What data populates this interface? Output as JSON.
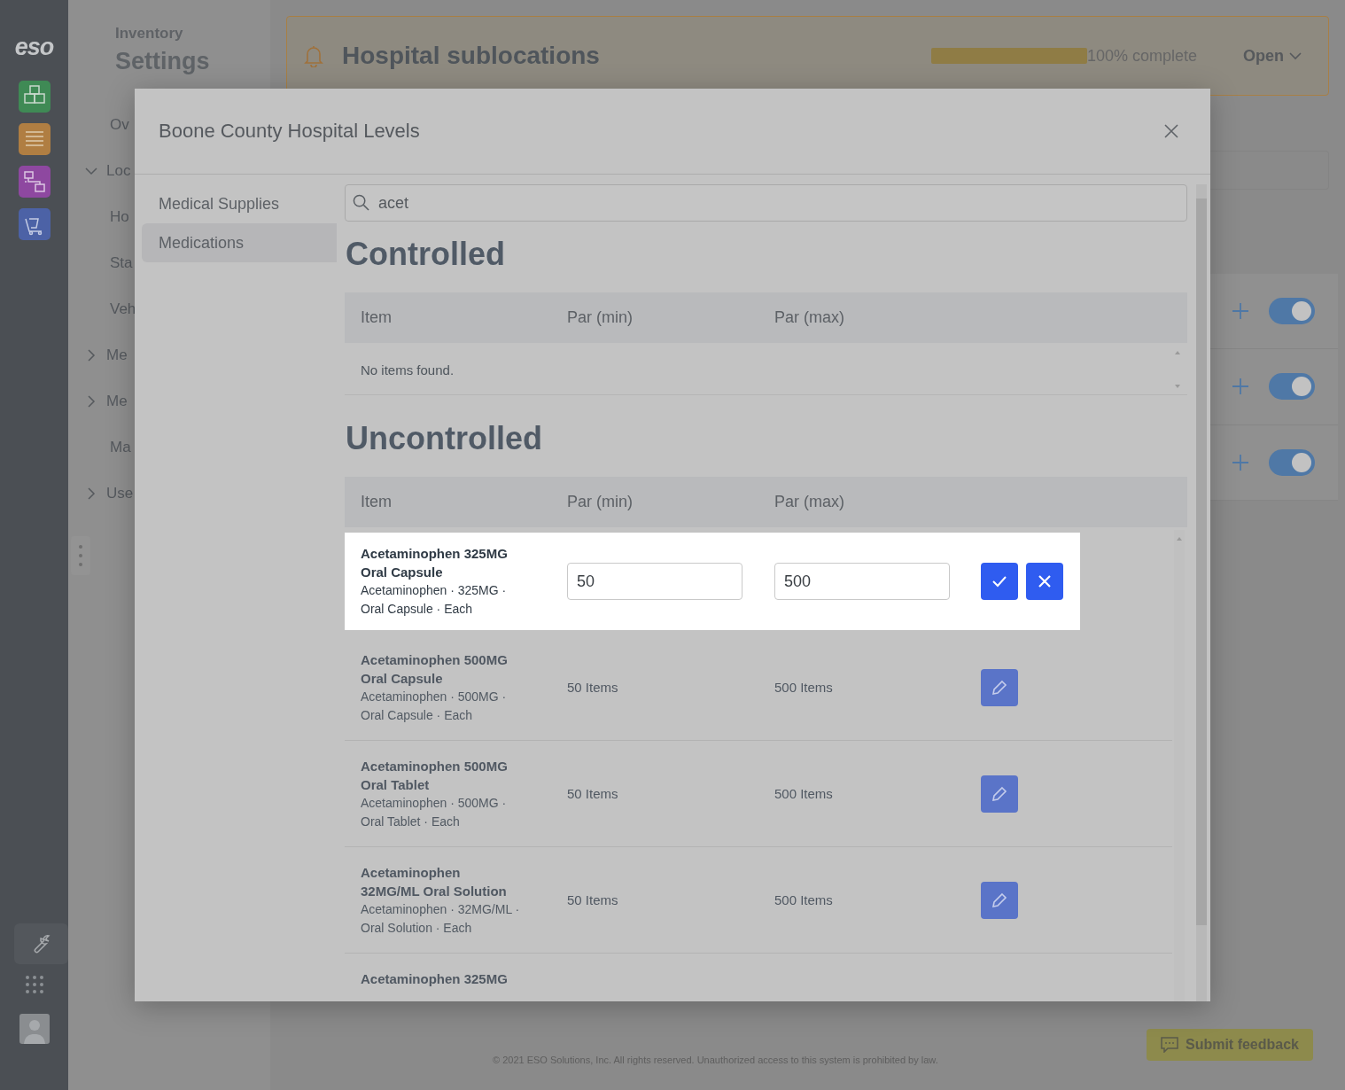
{
  "rail": {
    "logo": "eso"
  },
  "settings_nav": {
    "eyebrow": "Inventory",
    "title": "Settings",
    "items": [
      {
        "kind": "link",
        "label": "Ov"
      },
      {
        "kind": "group",
        "label": "Loc",
        "expanded": true,
        "children": [
          {
            "label": "Ho"
          },
          {
            "label": "Sta"
          },
          {
            "label": "Veh"
          }
        ]
      },
      {
        "kind": "group",
        "label": "Me",
        "expanded": false
      },
      {
        "kind": "group",
        "label": "Me",
        "expanded": false
      },
      {
        "kind": "link",
        "label": "Ma"
      },
      {
        "kind": "group",
        "label": "Use",
        "expanded": false
      }
    ]
  },
  "banner": {
    "title": "Hospital sublocations",
    "progress": {
      "level": 1,
      "label": "100% complete"
    },
    "action": "Open"
  },
  "side_list": {
    "rows": [
      {
        "on": true
      },
      {
        "on": true
      },
      {
        "on": true
      }
    ]
  },
  "footer": {
    "copyright": "© 2021 ESO Solutions, Inc. All rights reserved. Unauthorized access to this system is prohibited by law.",
    "feedback": "Submit feedback"
  },
  "modal": {
    "title": "Boone County Hospital Levels",
    "nav": [
      {
        "label": "Medical Supplies",
        "selected": false
      },
      {
        "label": "Medications",
        "selected": true
      }
    ],
    "search": {
      "value": "acet"
    },
    "sections": [
      {
        "title": "Controlled",
        "columns": [
          "Item",
          "Par (min)",
          "Par (max)"
        ],
        "empty": "No items found."
      },
      {
        "title": "Uncontrolled",
        "columns": [
          "Item",
          "Par (min)",
          "Par (max)"
        ],
        "rows": [
          {
            "name": "Acetaminophen 325MG Oral Capsule",
            "detail": "Acetaminophen · 325MG · Oral Capsule · Each",
            "editing": true,
            "min": "50",
            "max": "500"
          },
          {
            "name": "Acetaminophen 500MG Oral Capsule",
            "detail": "Acetaminophen · 500MG · Oral Capsule · Each",
            "editing": false,
            "min": "50 Items",
            "max": "500 Items"
          },
          {
            "name": "Acetaminophen 500MG Oral Tablet",
            "detail": "Acetaminophen · 500MG · Oral Tablet · Each",
            "editing": false,
            "min": "50 Items",
            "max": "500 Items"
          },
          {
            "name": "Acetaminophen 32MG/ML Oral Solution",
            "detail": "Acetaminophen · 32MG/ML · Oral Solution · Each",
            "editing": false,
            "min": "50 Items",
            "max": "500 Items"
          },
          {
            "name": "Acetaminophen 325MG",
            "editing": false
          }
        ]
      }
    ]
  }
}
